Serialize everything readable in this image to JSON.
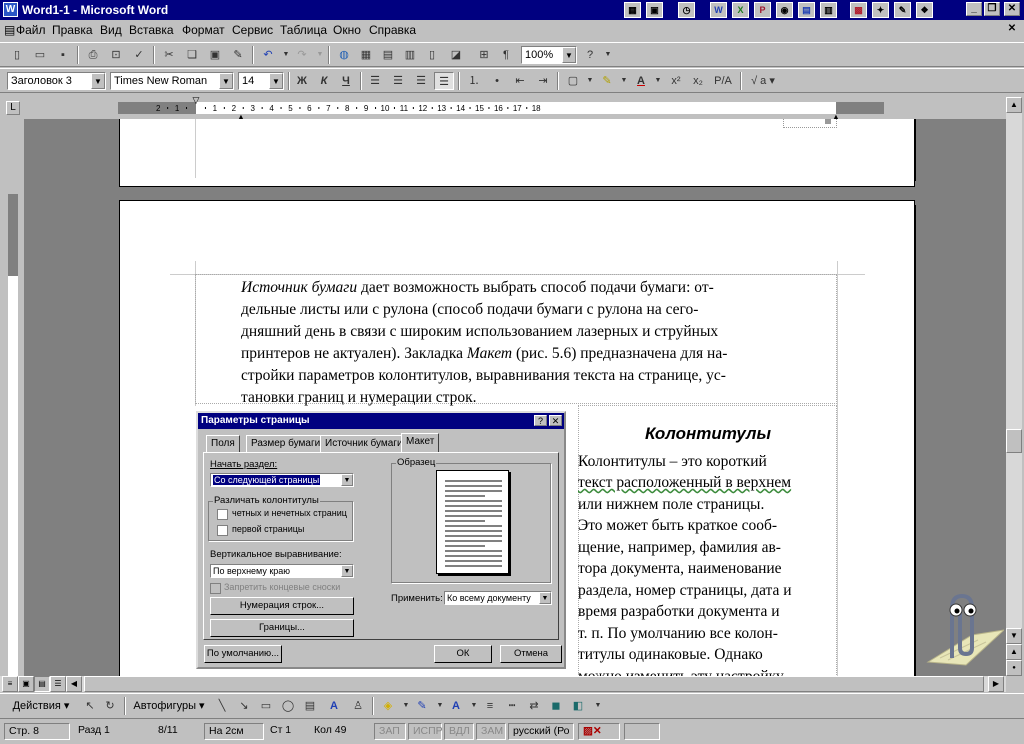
{
  "window": {
    "title": "Word1-1 - Microsoft Word"
  },
  "menu": [
    "Файл",
    "Правка",
    "Вид",
    "Вставка",
    "Формат",
    "Сервис",
    "Таблица",
    "Окно",
    "Справка"
  ],
  "format_toolbar": {
    "style": "Заголовок 3",
    "font": "Times New Roman",
    "size": "14",
    "bold": "Ж",
    "italic": "К",
    "underline": "Ч",
    "lang": "P/A"
  },
  "standard_toolbar": {
    "zoom": "100%"
  },
  "ruler": {
    "h_ticks": [
      "2",
      "1",
      "1",
      "2",
      "3",
      "4",
      "5",
      "6",
      "7",
      "8",
      "9",
      "10",
      "11",
      "12",
      "13",
      "14",
      "15",
      "16",
      "17",
      "18"
    ]
  },
  "document": {
    "paragraph_lines": [
      {
        "parts": [
          {
            "t": "Источник бумаги",
            "i": true
          },
          {
            "t": " дает возможность выбрать способ подачи бумаги:  от-"
          }
        ]
      },
      {
        "parts": [
          {
            "t": "дельные листы или с рулона (способ подачи бумаги с рулона на сего-"
          }
        ]
      },
      {
        "parts": [
          {
            "t": "дняшний день в связи с широким использованием лазерных и струйных"
          }
        ]
      },
      {
        "parts": [
          {
            "t": "принтеров не актуален). Закладка "
          },
          {
            "t": "Макет",
            "i": true
          },
          {
            "t": " (рис. 5.6) предназначена для на-"
          }
        ]
      },
      {
        "parts": [
          {
            "t": "стройки параметров колонтитулов, выравнивания текста на странице, ус-"
          }
        ]
      },
      {
        "parts": [
          {
            "t": "тановки границ и нумерации строк."
          }
        ]
      }
    ],
    "side_heading": "Колонтитулы",
    "side_lines": [
      "Колонтитулы  –  это  короткий",
      "текст расположенный в верхнем",
      "или   нижнем   поле   страницы.",
      "Это может быть краткое сооб-",
      "щение,  например,  фамилия  ав-",
      "тора  документа,  наименование",
      "раздела, номер страницы, дата и",
      "время  разработки  документа  и",
      "т.  п.  По  умолчанию  все  колон-",
      "титулы      одинаковые.      Однако",
      "можно изменить эту настройку"
    ]
  },
  "dialog": {
    "title": "Параметры страницы",
    "tabs": [
      "Поля",
      "Размер бумаги",
      "Источник бумаги",
      "Макет"
    ],
    "section_start_label": "Начать раздел:",
    "section_start_value": "Со следующей страницы",
    "headers_group": "Различать колонтитулы",
    "odd_even": "четных и нечетных страниц",
    "first_page": "первой страницы",
    "valign_label": "Вертикальное выравнивание:",
    "valign_value": "По верхнему краю",
    "suppress_endnotes": "Запретить концевые сноски",
    "line_numbers_btn": "Нумерация строк...",
    "borders_btn": "Границы...",
    "preview_label": "Образец",
    "apply_label": "Применить:",
    "apply_value": "Ко всему документу",
    "default_btn": "По умолчанию...",
    "ok_btn": "ОК",
    "cancel_btn": "Отмена"
  },
  "drawing_toolbar": {
    "actions": "Действия",
    "autoshapes": "Автофигуры"
  },
  "status": {
    "page": "Стр.  8",
    "section": "Разд  1",
    "pages": "8/11",
    "at": "На 2см",
    "line": "Ст  1",
    "col": "Кол  49",
    "rec": "ЗАП",
    "trk": "ИСПР",
    "ext": "ВДЛ",
    "ovr": "ЗАМ",
    "language": "русский (Ро"
  }
}
